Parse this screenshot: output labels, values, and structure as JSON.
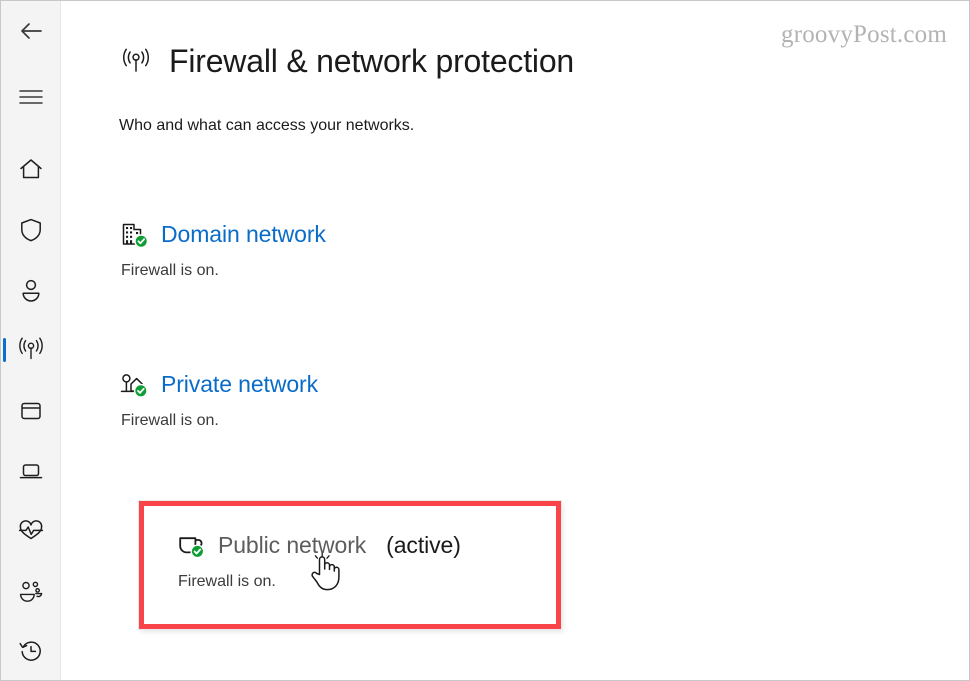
{
  "window": {
    "watermark": "groovyPost.com"
  },
  "sidebar": {
    "items": [
      {
        "name": "back-button",
        "icon": "back-arrow-icon",
        "label": "Back",
        "selected": false
      },
      {
        "name": "hamburger-menu-button",
        "icon": "hamburger-menu-icon",
        "label": "Menu",
        "selected": false
      },
      {
        "name": "sidebar-item-home",
        "icon": "home-icon",
        "label": "Home",
        "selected": false
      },
      {
        "name": "sidebar-item-virus",
        "icon": "shield-icon",
        "label": "Virus & threat protection",
        "selected": false
      },
      {
        "name": "sidebar-item-account",
        "icon": "person-icon",
        "label": "Account protection",
        "selected": false
      },
      {
        "name": "sidebar-item-firewall",
        "icon": "wireless-signal-icon",
        "label": "Firewall & network protection",
        "selected": true
      },
      {
        "name": "sidebar-item-app-browser",
        "icon": "app-window-icon",
        "label": "App & browser control",
        "selected": false
      },
      {
        "name": "sidebar-item-device-security",
        "icon": "device-icon",
        "label": "Device security",
        "selected": false
      },
      {
        "name": "sidebar-item-device-performance",
        "icon": "heart-pulse-icon",
        "label": "Device performance & health",
        "selected": false
      },
      {
        "name": "sidebar-item-family",
        "icon": "people-group-icon",
        "label": "Family options",
        "selected": false
      },
      {
        "name": "sidebar-item-history",
        "icon": "history-clock-icon",
        "label": "Protection history",
        "selected": false
      }
    ]
  },
  "page": {
    "icon": "wireless-signal-icon",
    "title": "Firewall & network protection",
    "subtitle": "Who and what can access your networks."
  },
  "profiles": [
    {
      "id": "domain",
      "icon": "building-check-icon",
      "link_label": "Domain network",
      "active_label": "",
      "status": "Firewall is on.",
      "is_link": true,
      "highlighted": false
    },
    {
      "id": "private",
      "icon": "house-check-icon",
      "link_label": "Private network",
      "active_label": "",
      "status": "Firewall is on.",
      "is_link": true,
      "highlighted": false
    },
    {
      "id": "public",
      "icon": "coffee-cup-check-icon",
      "link_label": "Public network",
      "active_label": "(active)",
      "status": "Firewall is on.",
      "is_link": false,
      "highlighted": true
    }
  ],
  "colors": {
    "link_blue": "#0a6cc9",
    "selection_blue": "#0a70d0",
    "status_green": "#0f9d35",
    "highlight_red": "#f9454a",
    "sidebar_bg": "#f4f4f4",
    "text_primary": "#1b1b1b",
    "watermark_gray": "#b3b3b3"
  }
}
